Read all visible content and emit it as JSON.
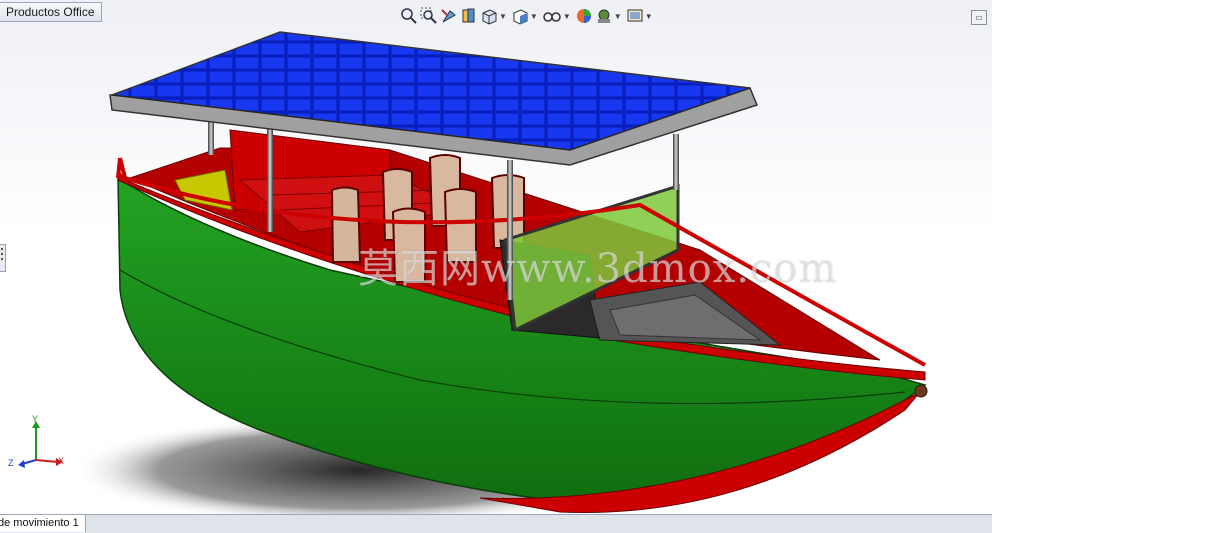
{
  "top_tab": {
    "label": "Productos Office"
  },
  "bottom_tab": {
    "label": "de movimiento 1"
  },
  "watermark": {
    "text": "莫西网www.3dmox.com"
  },
  "triad": {
    "x": "X",
    "y": "Y",
    "z": "Z"
  },
  "hud_icons": [
    "zoom-to-fit-icon",
    "zoom-area-icon",
    "previous-view-icon",
    "section-view-icon",
    "view-orientation-icon",
    "display-style-icon",
    "hide-show-icon",
    "edit-appearance-icon",
    "apply-scene-icon",
    "view-settings-icon"
  ],
  "colors": {
    "hull": "#1a8a1a",
    "trim": "#cc0000",
    "solar": "#0a1fcf",
    "frame": "#9a9a9a",
    "glass": "#7ec83a"
  }
}
